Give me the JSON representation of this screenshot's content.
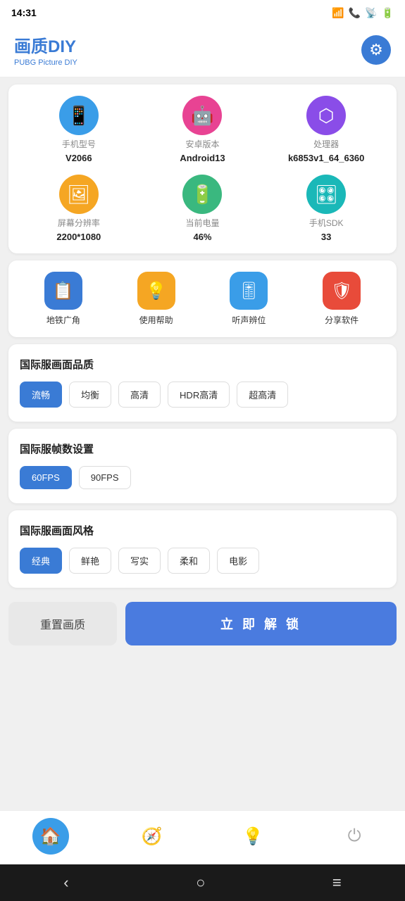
{
  "statusBar": {
    "time": "14:31",
    "icons": [
      "◂",
      "✓",
      "✉",
      "▶"
    ]
  },
  "header": {
    "title": "画质DIY",
    "subtitle": "PUBG Picture DIY",
    "gearIcon": "⚙"
  },
  "deviceInfo": {
    "items": [
      {
        "icon": "📱",
        "iconClass": "icon-blue",
        "label": "手机型号",
        "value": "V2066"
      },
      {
        "icon": "🤖",
        "iconClass": "icon-pink",
        "label": "安卓版本",
        "value": "Android13"
      },
      {
        "icon": "💠",
        "iconClass": "icon-purple",
        "label": "处理器",
        "value": "k6853v1_64_6360"
      },
      {
        "icon": "🖼",
        "iconClass": "icon-orange",
        "label": "屏幕分辨率",
        "value": "2200*1080"
      },
      {
        "icon": "🔋",
        "iconClass": "icon-green",
        "label": "当前电量",
        "value": "46%"
      },
      {
        "icon": "🎛",
        "iconClass": "icon-teal",
        "label": "手机SDK",
        "value": "33"
      }
    ]
  },
  "quickActions": [
    {
      "icon": "📋",
      "iconClass": "action-blue",
      "label": "地铁广角"
    },
    {
      "icon": "💡",
      "iconClass": "action-orange",
      "label": "使用帮助"
    },
    {
      "icon": "🎚",
      "iconClass": "action-blue2",
      "label": "听声辨位"
    },
    {
      "icon": "🛡",
      "iconClass": "action-red",
      "label": "分享软件"
    }
  ],
  "qualitySection": {
    "title": "国际服画面品质",
    "options": [
      "流畅",
      "均衡",
      "高清",
      "HDR高清",
      "超高清"
    ],
    "active": "流畅"
  },
  "fpsSection": {
    "title": "国际服帧数设置",
    "options": [
      "60FPS",
      "90FPS"
    ],
    "active": "60FPS"
  },
  "styleSection": {
    "title": "国际服画面风格",
    "options": [
      "经典",
      "鲜艳",
      "写实",
      "柔和",
      "电影"
    ],
    "active": "经典"
  },
  "bottomButtons": {
    "reset": "重置画质",
    "unlock": "立 即 解 锁"
  },
  "tabBar": {
    "tabs": [
      {
        "icon": "🏠",
        "active": true
      },
      {
        "icon": "🧭",
        "active": false
      },
      {
        "icon": "💡",
        "active": false
      },
      {
        "icon": "⏻",
        "active": false
      }
    ]
  },
  "sysNav": {
    "back": "‹",
    "home": "○",
    "menu": "≡"
  }
}
